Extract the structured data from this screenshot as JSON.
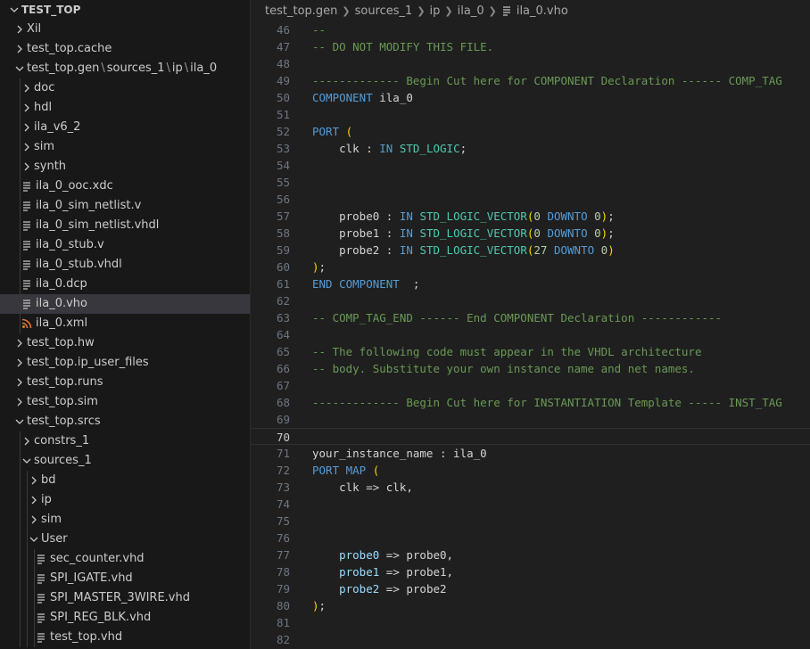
{
  "explorer": {
    "root": "TEST_TOP",
    "items": [
      {
        "label": "Xil",
        "depth": 1,
        "kind": "folder",
        "open": false
      },
      {
        "label": "test_top.cache",
        "depth": 1,
        "kind": "folder",
        "open": false
      },
      {
        "label": "test_top.gen",
        "depth": 1,
        "kind": "folder",
        "open": true,
        "compact": [
          "sources_1",
          "ip",
          "ila_0"
        ]
      },
      {
        "label": "doc",
        "depth": 2,
        "kind": "folder",
        "open": false
      },
      {
        "label": "hdl",
        "depth": 2,
        "kind": "folder",
        "open": false
      },
      {
        "label": "ila_v6_2",
        "depth": 2,
        "kind": "folder",
        "open": false
      },
      {
        "label": "sim",
        "depth": 2,
        "kind": "folder",
        "open": false
      },
      {
        "label": "synth",
        "depth": 2,
        "kind": "folder",
        "open": false
      },
      {
        "label": "ila_0_ooc.xdc",
        "depth": 2,
        "kind": "file"
      },
      {
        "label": "ila_0_sim_netlist.v",
        "depth": 2,
        "kind": "file"
      },
      {
        "label": "ila_0_sim_netlist.vhdl",
        "depth": 2,
        "kind": "file"
      },
      {
        "label": "ila_0_stub.v",
        "depth": 2,
        "kind": "file"
      },
      {
        "label": "ila_0_stub.vhdl",
        "depth": 2,
        "kind": "file"
      },
      {
        "label": "ila_0.dcp",
        "depth": 2,
        "kind": "file"
      },
      {
        "label": "ila_0.vho",
        "depth": 2,
        "kind": "file",
        "selected": true
      },
      {
        "label": "ila_0.xml",
        "depth": 2,
        "kind": "rss"
      },
      {
        "label": "test_top.hw",
        "depth": 1,
        "kind": "folder",
        "open": false
      },
      {
        "label": "test_top.ip_user_files",
        "depth": 1,
        "kind": "folder",
        "open": false
      },
      {
        "label": "test_top.runs",
        "depth": 1,
        "kind": "folder",
        "open": false
      },
      {
        "label": "test_top.sim",
        "depth": 1,
        "kind": "folder",
        "open": false
      },
      {
        "label": "test_top.srcs",
        "depth": 1,
        "kind": "folder",
        "open": true
      },
      {
        "label": "constrs_1",
        "depth": 2,
        "kind": "folder",
        "open": false
      },
      {
        "label": "sources_1",
        "depth": 2,
        "kind": "folder",
        "open": true
      },
      {
        "label": "bd",
        "depth": 3,
        "kind": "folder",
        "open": false
      },
      {
        "label": "ip",
        "depth": 3,
        "kind": "folder",
        "open": false
      },
      {
        "label": "sim",
        "depth": 3,
        "kind": "folder",
        "open": false
      },
      {
        "label": "User",
        "depth": 3,
        "kind": "folder",
        "open": true
      },
      {
        "label": "sec_counter.vhd",
        "depth": 4,
        "kind": "file"
      },
      {
        "label": "SPI_IGATE.vhd",
        "depth": 4,
        "kind": "file"
      },
      {
        "label": "SPI_MASTER_3WIRE.vhd",
        "depth": 4,
        "kind": "file"
      },
      {
        "label": "SPI_REG_BLK.vhd",
        "depth": 4,
        "kind": "file"
      },
      {
        "label": "test_top.vhd",
        "depth": 4,
        "kind": "file"
      }
    ]
  },
  "breadcrumb": [
    "test_top.gen",
    "sources_1",
    "ip",
    "ila_0",
    "ila_0.vho"
  ],
  "editor": {
    "current_line": 70,
    "lines": [
      {
        "n": 46,
        "t": [
          [
            "cm",
            "--"
          ]
        ]
      },
      {
        "n": 47,
        "t": [
          [
            "cm",
            "-- DO NOT MODIFY THIS FILE."
          ]
        ]
      },
      {
        "n": 48,
        "t": []
      },
      {
        "n": 49,
        "t": [
          [
            "cm",
            "------------- Begin Cut here for COMPONENT Declaration ------ COMP_TAG"
          ]
        ]
      },
      {
        "n": 50,
        "t": [
          [
            "kw",
            "COMPONENT"
          ],
          [
            "op",
            " ila_0"
          ]
        ]
      },
      {
        "n": 51,
        "t": []
      },
      {
        "n": 52,
        "t": [
          [
            "kw",
            "PORT"
          ],
          [
            "op",
            " "
          ],
          [
            "pn",
            "("
          ]
        ]
      },
      {
        "n": 53,
        "t": [
          [
            "op",
            "    clk : "
          ],
          [
            "kw",
            "IN"
          ],
          [
            "op",
            " "
          ],
          [
            "ty",
            "STD_LOGIC"
          ],
          [
            "op",
            ";"
          ]
        ]
      },
      {
        "n": 54,
        "t": []
      },
      {
        "n": 55,
        "t": []
      },
      {
        "n": 56,
        "t": []
      },
      {
        "n": 57,
        "t": [
          [
            "op",
            "    probe0 : "
          ],
          [
            "kw",
            "IN"
          ],
          [
            "op",
            " "
          ],
          [
            "ty",
            "STD_LOGIC_VECTOR"
          ],
          [
            "pn",
            "("
          ],
          [
            "nm",
            "0"
          ],
          [
            "op",
            " "
          ],
          [
            "kw",
            "DOWNTO"
          ],
          [
            "op",
            " "
          ],
          [
            "nm",
            "0"
          ],
          [
            "pn",
            ")"
          ],
          [
            "op",
            ";"
          ]
        ]
      },
      {
        "n": 58,
        "t": [
          [
            "op",
            "    probe1 : "
          ],
          [
            "kw",
            "IN"
          ],
          [
            "op",
            " "
          ],
          [
            "ty",
            "STD_LOGIC_VECTOR"
          ],
          [
            "pn",
            "("
          ],
          [
            "nm",
            "0"
          ],
          [
            "op",
            " "
          ],
          [
            "kw",
            "DOWNTO"
          ],
          [
            "op",
            " "
          ],
          [
            "nm",
            "0"
          ],
          [
            "pn",
            ")"
          ],
          [
            "op",
            ";"
          ]
        ]
      },
      {
        "n": 59,
        "t": [
          [
            "op",
            "    probe2 : "
          ],
          [
            "kw",
            "IN"
          ],
          [
            "op",
            " "
          ],
          [
            "ty",
            "STD_LOGIC_VECTOR"
          ],
          [
            "pn",
            "("
          ],
          [
            "nm",
            "27"
          ],
          [
            "op",
            " "
          ],
          [
            "kw",
            "DOWNTO"
          ],
          [
            "op",
            " "
          ],
          [
            "nm",
            "0"
          ],
          [
            "pn",
            ")"
          ]
        ]
      },
      {
        "n": 60,
        "t": [
          [
            "pn",
            ")"
          ],
          [
            "op",
            ";"
          ]
        ]
      },
      {
        "n": 61,
        "t": [
          [
            "kw",
            "END COMPONENT"
          ],
          [
            "op",
            "  ;"
          ]
        ]
      },
      {
        "n": 62,
        "t": []
      },
      {
        "n": 63,
        "t": [
          [
            "cm",
            "-- COMP_TAG_END ------ End COMPONENT Declaration ------------"
          ]
        ]
      },
      {
        "n": 64,
        "t": []
      },
      {
        "n": 65,
        "t": [
          [
            "cm",
            "-- The following code must appear in the VHDL architecture"
          ]
        ]
      },
      {
        "n": 66,
        "t": [
          [
            "cm",
            "-- body. Substitute your own instance name and net names."
          ]
        ]
      },
      {
        "n": 67,
        "t": []
      },
      {
        "n": 68,
        "t": [
          [
            "cm",
            "------------- Begin Cut here for INSTANTIATION Template ----- INST_TAG"
          ]
        ]
      },
      {
        "n": 69,
        "t": []
      },
      {
        "n": 70,
        "t": []
      },
      {
        "n": 71,
        "t": [
          [
            "op",
            "your_instance_name : ila_0"
          ]
        ]
      },
      {
        "n": 72,
        "t": [
          [
            "kw",
            "PORT MAP"
          ],
          [
            "op",
            " "
          ],
          [
            "pn",
            "("
          ]
        ]
      },
      {
        "n": 73,
        "t": [
          [
            "op",
            "    clk => clk,"
          ]
        ]
      },
      {
        "n": 74,
        "t": []
      },
      {
        "n": 75,
        "t": []
      },
      {
        "n": 76,
        "t": []
      },
      {
        "n": 77,
        "t": [
          [
            "op",
            "    "
          ],
          [
            "id",
            "probe0"
          ],
          [
            "op",
            " => probe0,"
          ]
        ]
      },
      {
        "n": 78,
        "t": [
          [
            "op",
            "    "
          ],
          [
            "id",
            "probe1"
          ],
          [
            "op",
            " => probe1,"
          ]
        ]
      },
      {
        "n": 79,
        "t": [
          [
            "op",
            "    "
          ],
          [
            "id",
            "probe2"
          ],
          [
            "op",
            " => probe2"
          ]
        ]
      },
      {
        "n": 80,
        "t": [
          [
            "pn",
            ")"
          ],
          [
            "op",
            ";"
          ]
        ]
      },
      {
        "n": 81,
        "t": []
      },
      {
        "n": 82,
        "t": []
      }
    ]
  }
}
